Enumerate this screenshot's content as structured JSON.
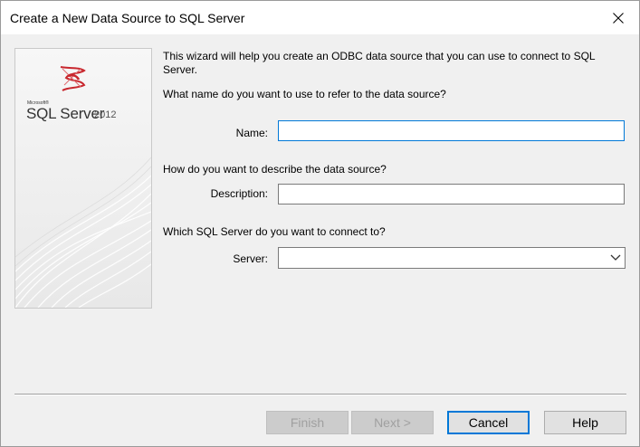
{
  "window": {
    "title": "Create a New Data Source to SQL Server"
  },
  "banner": {
    "microsoft_text": "Microsoft®",
    "product": "SQL Server",
    "version": "2012",
    "logo_icon": "sql-server-logo-icon"
  },
  "intro": "This wizard will help you create an ODBC data source that you can use to connect to SQL Server.",
  "name_section": {
    "question": "What name do you want to use to refer to the data source?",
    "label": "Name:",
    "value": ""
  },
  "description_section": {
    "question": "How do you want to describe the data source?",
    "label": "Description:",
    "value": ""
  },
  "server_section": {
    "question": "Which SQL Server do you want to connect to?",
    "label": "Server:",
    "value": "",
    "dropdown_icon": "chevron-down-icon"
  },
  "buttons": {
    "finish": "Finish",
    "next": "Next >",
    "cancel": "Cancel",
    "help": "Help"
  },
  "colors": {
    "focus_accent": "#0078d7",
    "logo_red": "#c8272e",
    "dialog_bg": "#f0f0f0"
  }
}
